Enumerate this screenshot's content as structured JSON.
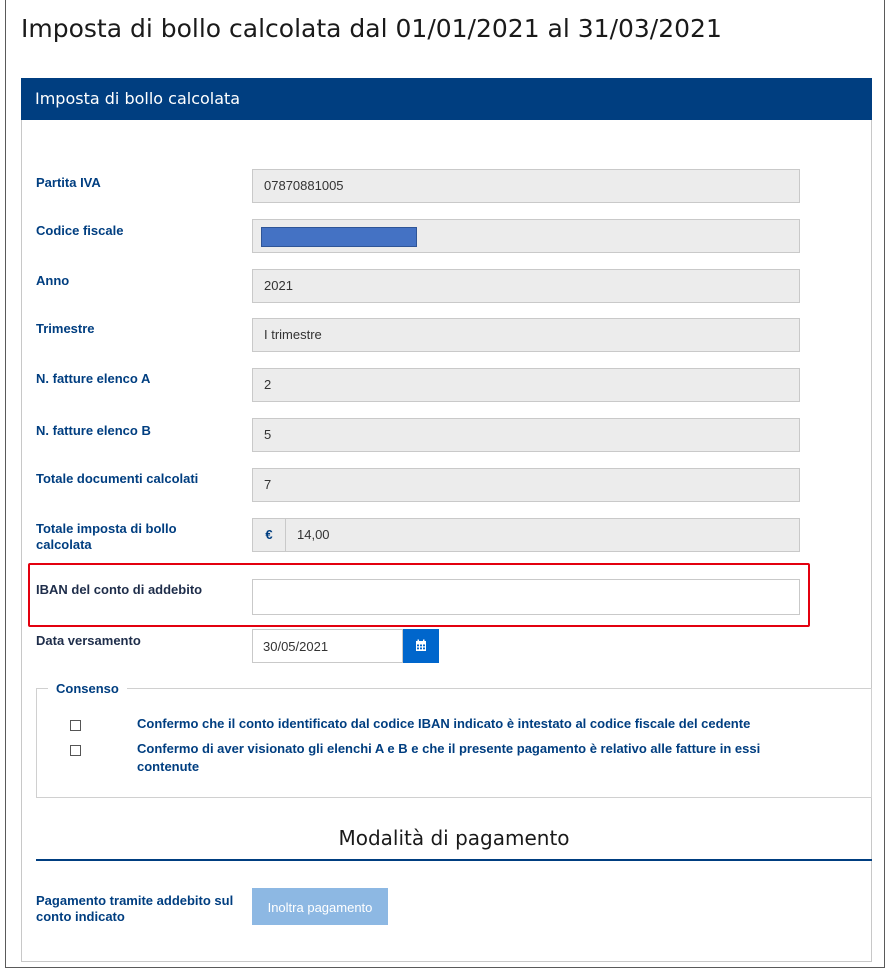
{
  "page": {
    "title": "Imposta di bollo calcolata dal 01/01/2021 al 31/03/2021"
  },
  "panel": {
    "header": "Imposta di bollo calcolata"
  },
  "fields": {
    "partita_iva": {
      "label": "Partita IVA",
      "value": "07870881005"
    },
    "codice_fiscale": {
      "label": "Codice fiscale",
      "value": ""
    },
    "anno": {
      "label": "Anno",
      "value": "2021"
    },
    "trimestre": {
      "label": "Trimestre",
      "value": "I trimestre"
    },
    "fatture_a": {
      "label": "N. fatture elenco A",
      "value": "2"
    },
    "fatture_b": {
      "label": "N. fatture elenco B",
      "value": "5"
    },
    "totale_documenti": {
      "label": "Totale documenti calcolati",
      "value": "7"
    },
    "totale_imposta": {
      "label": "Totale imposta di bollo calcolata",
      "currency": "€",
      "value": "14,00"
    }
  },
  "iban": {
    "label": "IBAN del conto di addebito",
    "value": ""
  },
  "data_versamento": {
    "label": "Data versamento",
    "value": "30/05/2021",
    "icon": "calendar-icon"
  },
  "consenso": {
    "legend": "Consenso",
    "items": [
      {
        "label": "Confermo che il conto identificato dal codice IBAN indicato è intestato al codice fiscale del cedente",
        "checked": false
      },
      {
        "label": "Confermo di aver visionato gli elenchi A e B e che il presente pagamento è relativo alle fatture in essi contenute",
        "checked": false
      }
    ]
  },
  "pagamento": {
    "title": "Modalità di pagamento",
    "label": "Pagamento tramite addebito sul conto indicato",
    "button": "Inoltra pagamento"
  },
  "colors": {
    "header_bg": "#003e80",
    "label": "#003e80",
    "highlight": "#e3000f",
    "calendar_btn": "#0066cc",
    "pay_btn": "#8db8e3"
  }
}
